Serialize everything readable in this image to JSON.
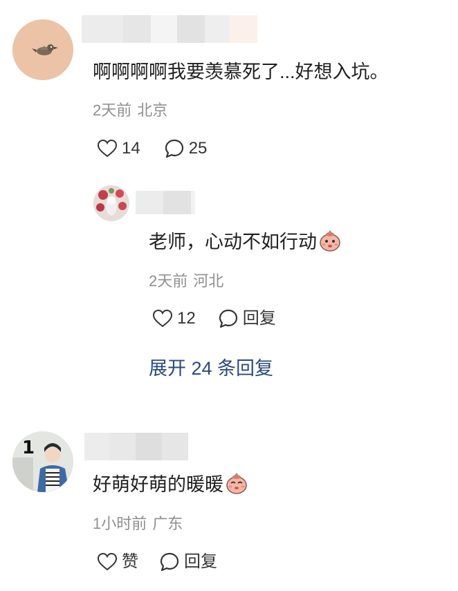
{
  "comments": [
    {
      "content": "啊啊啊啊我要羡慕死了...好想入坑。",
      "time": "2天前",
      "location": "北京",
      "likes": "14",
      "replies": "25",
      "sub_reply": {
        "content": "老师，心动不如行动",
        "time": "2天前",
        "location": "河北",
        "likes": "12",
        "reply_label": "回复"
      },
      "expand_label": "展开 24 条回复"
    },
    {
      "content": "好萌好萌的暖暖",
      "time": "1小时前",
      "location": "广东",
      "like_label": "赞",
      "reply_label": "回复"
    }
  ],
  "colors": {
    "expand_link": "#2a4a7f",
    "meta_text": "#8f8f8f"
  },
  "icons": [
    "heart-icon",
    "comment-bubble-icon",
    "emoji-icon"
  ]
}
